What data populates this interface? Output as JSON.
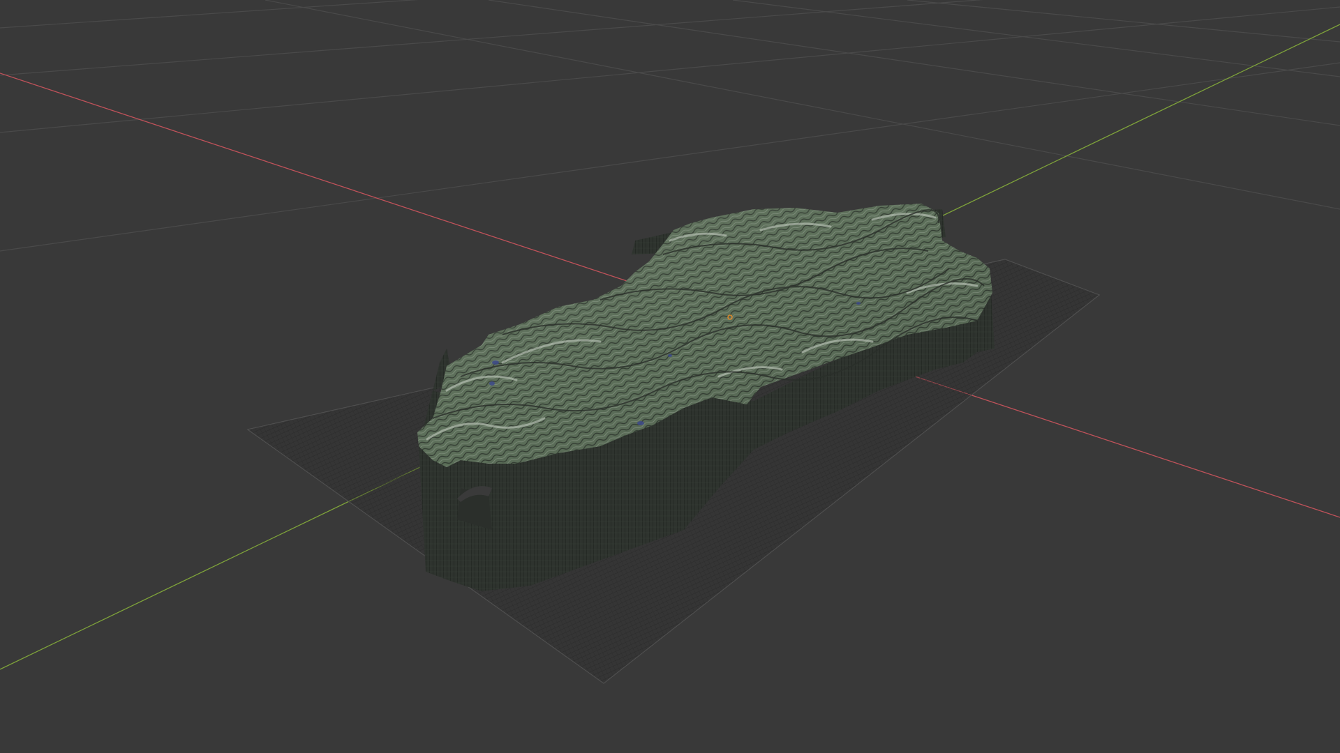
{
  "viewport": {
    "background": "#393939",
    "grid_color": "#4a4a4a",
    "x_axis_color": "#c0525a",
    "y_axis_color": "#7ea23a"
  },
  "terrain": {
    "top_color": "#5e6f5e",
    "highlight_color": "#a9b4a6",
    "side_color": "#2d322d",
    "water_color": "#3d4a8a",
    "plane_wire_color": "#2b2b2b"
  },
  "origin_marker_color": "#e08a2a"
}
